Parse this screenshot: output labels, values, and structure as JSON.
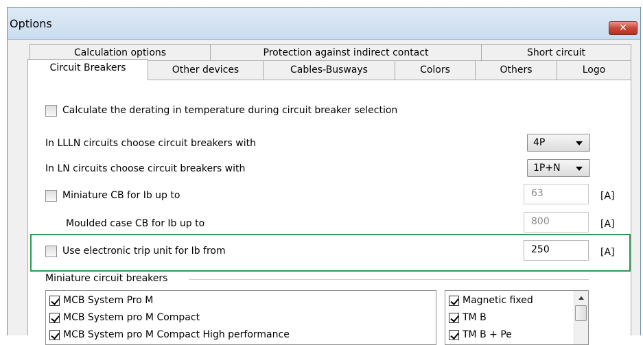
{
  "window": {
    "title": "Options",
    "close_label": "✕"
  },
  "tabs": {
    "row1": [
      "Calculation options",
      "Protection against indirect contact",
      "Short circuit"
    ],
    "row2": [
      "Circuit Breakers",
      "Other devices",
      "Cables-Busways",
      "Colors",
      "Others",
      "Logo"
    ],
    "active": "Circuit Breakers"
  },
  "panel": {
    "derating": {
      "label": "Calculate the derating in temperature during circuit breaker selection",
      "checked": false
    },
    "llln": {
      "label": "In LLLN circuits choose circuit breakers with",
      "value": "4P"
    },
    "ln": {
      "label": "In LN circuits choose circuit breakers with",
      "value": "1P+N"
    },
    "miniature_cb": {
      "label": "Miniature CB for Ib up to",
      "checked": false,
      "value": "63",
      "unit": "[A]"
    },
    "moulded_cb": {
      "label": "Moulded case CB for Ib up to",
      "value": "800",
      "unit": "[A]"
    },
    "electronic_trip": {
      "label": "Use electronic trip unit for Ib from",
      "checked": false,
      "value": "250",
      "unit": "[A]"
    },
    "mcb_group": {
      "label": "Miniature circuit breakers",
      "systems": [
        {
          "label": "MCB System Pro M",
          "checked": true
        },
        {
          "label": "MCB System pro M Compact",
          "checked": true
        },
        {
          "label": "MCB System pro M Compact High performance",
          "checked": true
        }
      ],
      "releases": [
        {
          "label": "Magnetic fixed",
          "checked": true
        },
        {
          "label": "TM B",
          "checked": true
        },
        {
          "label": "TM B + Pe",
          "checked": true
        }
      ]
    }
  },
  "colors": {
    "highlight": "#2e9a52",
    "close_button": "#c9473a"
  }
}
